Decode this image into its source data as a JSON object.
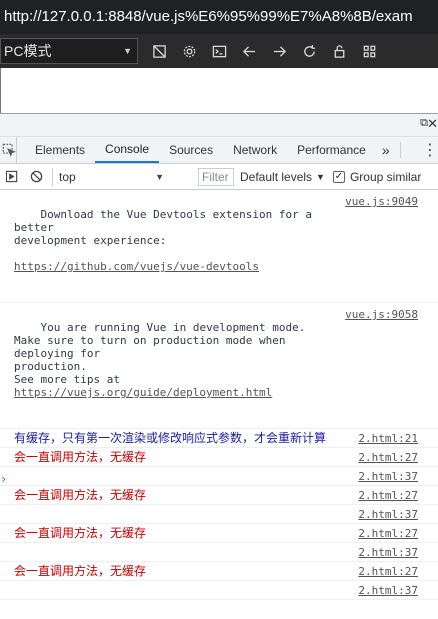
{
  "browser": {
    "url": "http://127.0.0.1:8848/vue.js%E6%95%99%E7%A8%8B/exam",
    "mode_select": "PC模式"
  },
  "devtools": {
    "tabs": [
      {
        "label": "Elements"
      },
      {
        "label": "Console"
      },
      {
        "label": "Sources"
      },
      {
        "label": "Network"
      },
      {
        "label": "Performance"
      }
    ],
    "more_tabs": "»",
    "console_bar": {
      "context": "top",
      "filter_placeholder": "Filter",
      "levels": "Default levels",
      "group_similar": "Group similar"
    }
  },
  "console": {
    "info_messages": [
      {
        "text": "Download the Vue Devtools extension for a better\ndevelopment experience:",
        "link": "https://github.com/vuejs/vue-devtools",
        "source": "vue.js:9049"
      },
      {
        "text": "You are running Vue in development mode.\nMake sure to turn on production mode when deploying for\nproduction.\nSee more tips at ",
        "link": "https://vuejs.org/guide/deployment.html",
        "source": "vue.js:9058"
      }
    ],
    "log_lines": [
      {
        "text": "有缓存，只有第一次渲染或修改响应式参数，才会重新计算",
        "source": "2.html:21",
        "color": "#1a1aa6"
      },
      {
        "text": "会一直调用方法，无缓存",
        "source": "2.html:27",
        "color": "#c80000"
      },
      {
        "text": "",
        "source": "2.html:37",
        "color": "#303942"
      },
      {
        "text": "会一直调用方法，无缓存",
        "source": "2.html:27",
        "color": "#c80000"
      },
      {
        "text": "",
        "source": "2.html:37",
        "color": "#303942"
      },
      {
        "text": "会一直调用方法，无缓存",
        "source": "2.html:27",
        "color": "#c80000"
      },
      {
        "text": "",
        "source": "2.html:37",
        "color": "#303942"
      },
      {
        "text": "会一直调用方法，无缓存",
        "source": "2.html:27",
        "color": "#c80000"
      },
      {
        "text": "",
        "source": "2.html:37",
        "color": "#303942"
      }
    ],
    "prompt": "›"
  },
  "colors": {
    "active_tab_underline": "#1a73e8",
    "chrome_dark": "#202124"
  }
}
